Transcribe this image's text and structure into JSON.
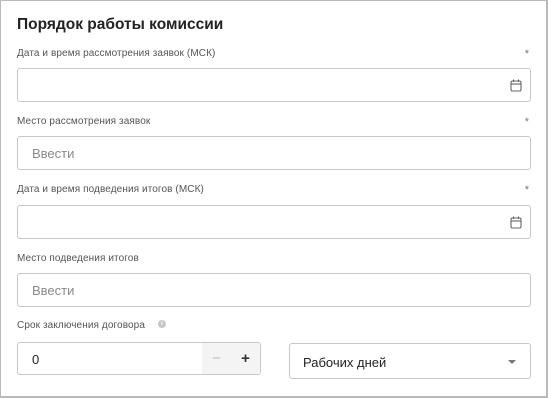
{
  "section": {
    "title": "Порядок работы комиссии"
  },
  "fields": {
    "review_datetime": {
      "label": "Дата и время рассмотрения заявок (МСК)",
      "required_mark": "*",
      "value": "",
      "icon": "calendar-icon"
    },
    "review_place": {
      "label": "Место рассмотрения заявок",
      "required_mark": "*",
      "placeholder": "Ввести"
    },
    "summary_datetime": {
      "label": "Дата и время подведения итогов (МСК)",
      "required_mark": "*",
      "value": "",
      "icon": "calendar-icon"
    },
    "summary_place": {
      "label": "Место подведения итогов",
      "placeholder": "Ввести"
    },
    "contract_term": {
      "label": "Срок заключения договора",
      "info_icon": "info-icon",
      "value": "0",
      "minus": "−",
      "plus": "+",
      "unit_selected": "Рабочих дней"
    }
  }
}
